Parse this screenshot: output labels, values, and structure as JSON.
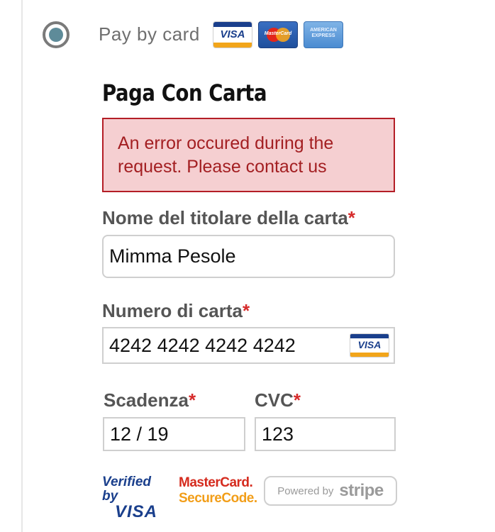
{
  "payment_option": {
    "label": "Pay by card",
    "selected": true,
    "card_brands": [
      {
        "icon": "visa-logo-icon",
        "text": "VISA"
      },
      {
        "icon": "mastercard-logo-icon",
        "text": "MasterCard"
      },
      {
        "icon": "amex-logo-icon",
        "text": "AMERICAN EXPRESS"
      }
    ]
  },
  "form": {
    "title": "Paga Con Carta",
    "error_message": "An error occured during the request. Please contact us",
    "required_marker": "*",
    "cardholder": {
      "label": "Nome del titolare della carta",
      "value": "Mimma Pesole"
    },
    "card_number": {
      "label": "Numero di carta",
      "value": "4242 4242 4242 4242",
      "brand_text": "VISA"
    },
    "expiry": {
      "label": "Scadenza",
      "value": "12 / 19"
    },
    "cvc": {
      "label": "CVC",
      "value": "123"
    }
  },
  "badges": {
    "verified_by_visa": {
      "line1": "Verified by",
      "line2": "VISA"
    },
    "mastercard_securecode": {
      "line1": "MasterCard.",
      "line2": "SecureCode."
    },
    "stripe": {
      "prefix": "Powered by",
      "brand": "stripe"
    }
  },
  "colors": {
    "radio_fill": "#5e8b99",
    "error_bg": "#f5cfd1",
    "error_border": "#b41e26",
    "required": "#d62b2b",
    "label": "#555555"
  }
}
